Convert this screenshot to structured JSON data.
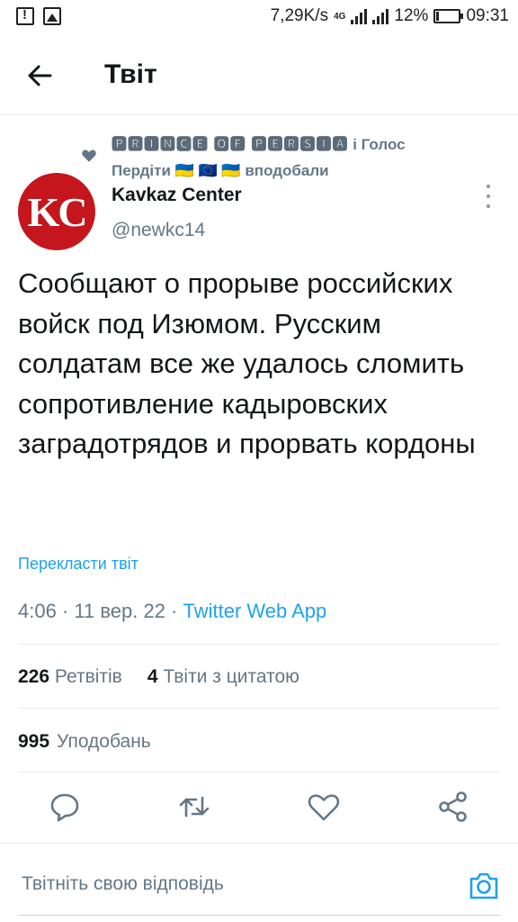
{
  "status_bar": {
    "speed": "7,29K/s",
    "network": "4G",
    "battery_percent": "12%",
    "battery_level": 0.12,
    "time": "09:31"
  },
  "header": {
    "back_icon": "arrow-left-icon",
    "title": "Твіт"
  },
  "social_context": {
    "icon": "heart-icon",
    "user1": "🅿🆁🅸🅽🅲🅴 🅾🅵 🅿🅴🆁🆂🅸🅰",
    "conjunction": "і Голос",
    "user2": "Пердіти 🇺🇦 🇪🇺 🇺🇦",
    "action": "вподобали"
  },
  "author": {
    "avatar_text": "KC",
    "name": "Kavkaz Center",
    "handle": "@newkc14"
  },
  "tweet": {
    "text": "Сообщают о прорыве российских войск под Изюмом. Русским солдатам все же удалось сломить сопротивление кадыровских заградотрядов и прорвать кордоны",
    "translate_link": "Перекласти твіт",
    "timestamp": "4:06 · 11 вер. 22 · ",
    "source_app": "Twitter Web App"
  },
  "stats": {
    "retweets_count": "226",
    "retweets_label": "Ретвітів",
    "quotes_count": "4",
    "quotes_label": "Твіти з цитатою",
    "likes_count": "995",
    "likes_label": "Уподобань"
  },
  "actions": [
    "reply-icon",
    "retweet-icon",
    "like-icon",
    "share-icon"
  ],
  "reply_bar": {
    "placeholder": "Твітніть свою відповідь",
    "camera_icon": "camera-icon"
  },
  "colors": {
    "accent": "#1da1f2",
    "secondary_text": "#657786",
    "avatar_bg": "#c4161c"
  }
}
